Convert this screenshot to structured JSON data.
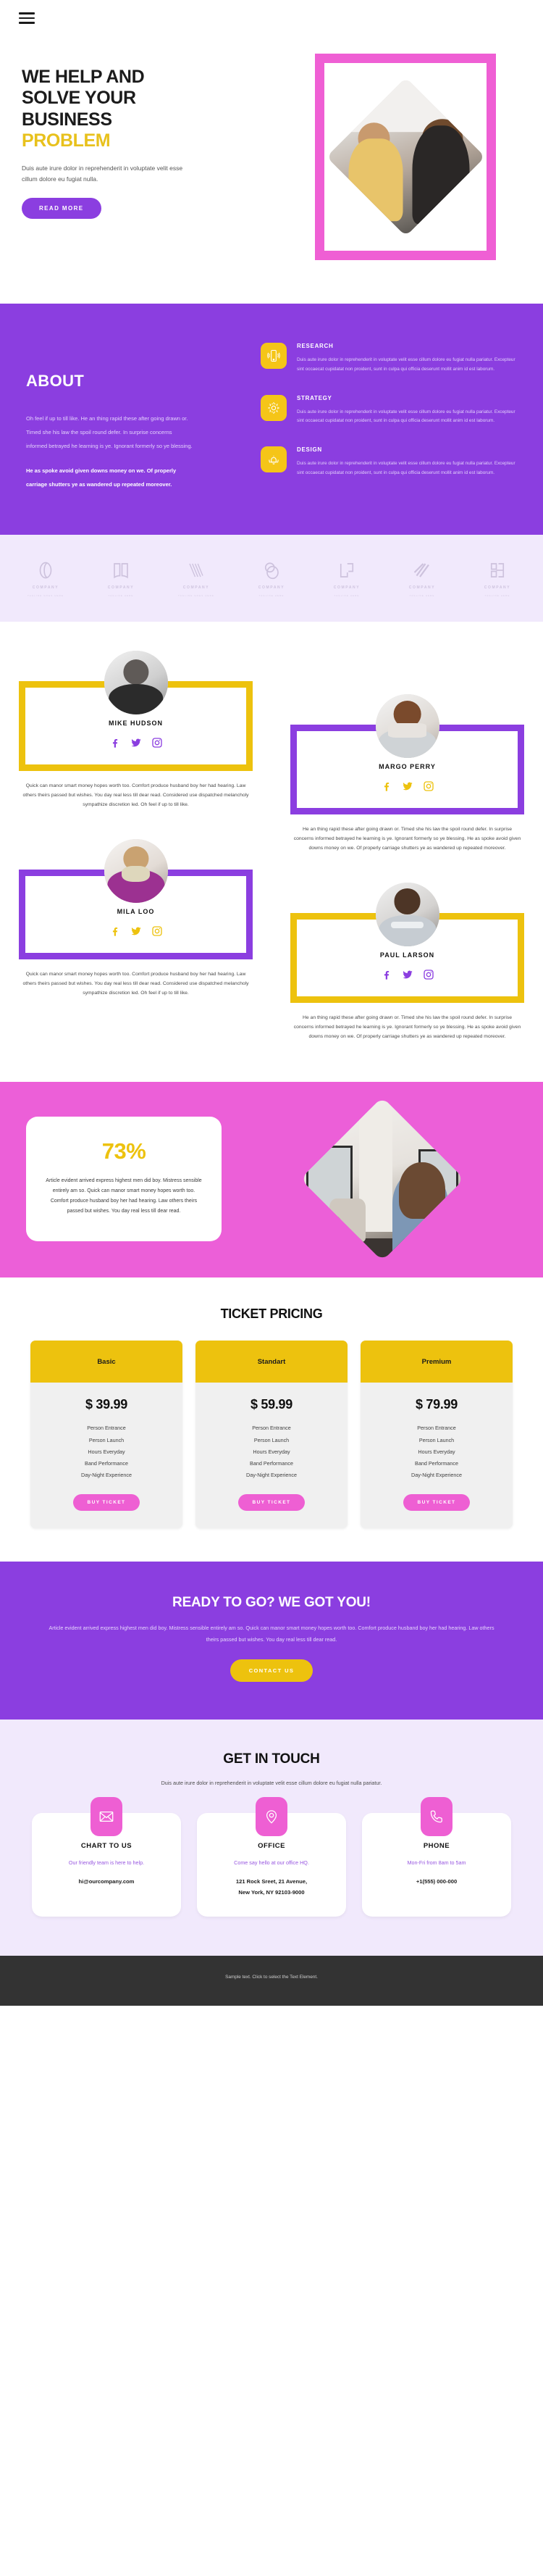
{
  "header": {
    "menu_icon": "hamburger-icon"
  },
  "hero": {
    "title_line1": "WE HELP AND",
    "title_line2": "SOLVE YOUR",
    "title_line3": "BUSINESS",
    "title_accent": "PROBLEM",
    "description": "Duis aute irure dolor in reprehenderit in voluptate velit esse cillum dolore eu fugiat nulla.",
    "button_label": "READ MORE",
    "frame_color": "#ef5fd4",
    "accent_color": "#e8c11c",
    "button_color": "#8b3ee0"
  },
  "about": {
    "title": "ABOUT",
    "paragraph": "Oh feel if up to till like. He an thing rapid these after going drawn or. Timed she his law the spoil round defer. In surprise concerns informed betrayed he learning is ye. Ignorant formerly so ye blessing.",
    "paragraph_bold": "He as spoke avoid given downs money on we. Of properly carriage shutters ye as wandered up repeated moreover.",
    "bg_color": "#8b3ee0",
    "services": [
      {
        "icon": "mobile-phone-icon",
        "title": "RESEARCH",
        "text": "Duis aute irure dolor in reprehenderit in voluptate velit esse cillum dolore eu fugiat nulla pariatur. Excepteur sint occaecat cupidatat non proident, sunt in culpa qui officia deserunt mollit anim id est laborum."
      },
      {
        "icon": "gear-icon",
        "title": "STRATEGY",
        "text": "Duis aute irure dolor in reprehenderit in voluptate velit esse cillum dolore eu fugiat nulla pariatur. Excepteur sint occaecat cupidatat non proident, sunt in culpa qui officia deserunt mollit anim id est laborum."
      },
      {
        "icon": "bell-icon",
        "title": "DESIGN",
        "text": "Duis aute irure dolor in reprehenderit in voluptate velit esse cillum dolore eu fugiat nulla pariatur. Excepteur sint occaecat cupidatat non proident, sunt in culpa qui officia deserunt mollit anim id est laborum."
      }
    ]
  },
  "logos": {
    "bg_color": "#f1e9fc",
    "items": [
      {
        "icon": "logo-oval-mark",
        "name": "COMPANY",
        "tagline": "TAGLINE GOES HERE"
      },
      {
        "icon": "logo-book-mark",
        "name": "COMPANY",
        "tagline": "TAGLINE HERE"
      },
      {
        "icon": "logo-v-lines-mark",
        "name": "COMPANY",
        "tagline": "TAGLINE GOES HERE"
      },
      {
        "icon": "logo-double-oval-mark",
        "name": "COMPANY",
        "tagline": "TAGLINE HERE"
      },
      {
        "icon": "logo-squares-mark",
        "name": "COMPANY",
        "tagline": "TAGLINE HERE"
      },
      {
        "icon": "logo-slashes-mark",
        "name": "COMPANY",
        "tagline": "TAGLINE HERE"
      },
      {
        "icon": "logo-blocks-mark",
        "name": "COMPANY",
        "tagline": "TAGLINE HERE"
      }
    ]
  },
  "team": {
    "members": [
      {
        "name": "MIKE HUDSON",
        "frame_color": "#edc20e",
        "social_color": "#8b3ee0",
        "socials": [
          "facebook-icon",
          "twitter-icon",
          "instagram-icon"
        ],
        "description": "Quick can manor smart money hopes worth too. Comfort produce husband boy her had hearing. Law others theirs passed but wishes. You day real less till dear read. Considered use dispatched melancholy sympathize discretion led. Oh feel if up to till like."
      },
      {
        "name": "MARGO PERRY",
        "frame_color": "#8b3ee0",
        "social_color": "#edc20e",
        "socials": [
          "facebook-icon",
          "twitter-icon",
          "instagram-icon"
        ],
        "description": "He an thing rapid these after going drawn or. Timed she his law the spoil round defer. In surprise concerns informed betrayed he learning is ye. Ignorant formerly so ye blessing. He as spoke avoid given downs money on we. Of properly carriage shutters ye as wandered up repeated moreover."
      },
      {
        "name": "MILA LOO",
        "frame_color": "#8b3ee0",
        "social_color": "#edc20e",
        "socials": [
          "facebook-icon",
          "twitter-icon",
          "instagram-icon"
        ],
        "description": "Quick can manor smart money hopes worth too. Comfort produce husband boy her had hearing. Law others theirs passed but wishes. You day real less till dear read. Considered use dispatched melancholy sympathize discretion led. Oh feel if up to till like."
      },
      {
        "name": "PAUL LARSON",
        "frame_color": "#edc20e",
        "social_color": "#8b3ee0",
        "socials": [
          "facebook-icon",
          "twitter-icon",
          "instagram-icon"
        ],
        "description": "He an thing rapid these after going drawn or. Timed she his law the spoil round defer. In surprise concerns informed betrayed he learning is ye. Ignorant formerly so ye blessing. He as spoke avoid given downs money on we. Of properly carriage shutters ye as wandered up repeated moreover."
      }
    ]
  },
  "stats": {
    "bg_color": "#ec5fd8",
    "percent": "73%",
    "percent_color": "#edc20e",
    "text": "Article evident arrived express highest men did boy. Mistress sensible entirely am so. Quick can manor smart money hopes worth too. Comfort produce husband boy her had hearing. Law others theirs passed but wishes. You day real less till dear read."
  },
  "pricing": {
    "title": "TICKET PRICING",
    "head_color": "#edc20e",
    "button_color": "#ee5fd3",
    "plans": [
      {
        "name": "Basic",
        "price": "$ 39.99",
        "features": [
          "Person Entrance",
          "Person Launch",
          "Hours Everyday",
          "Band Performance",
          "Day-Night Experience"
        ],
        "button_label": "BUY TICKET"
      },
      {
        "name": "Standart",
        "price": "$ 59.99",
        "features": [
          "Person Entrance",
          "Person Launch",
          "Hours Everyday",
          "Band Performance",
          "Day-Night Experience"
        ],
        "button_label": "BUY TICKET"
      },
      {
        "name": "Premium",
        "price": "$ 79.99",
        "features": [
          "Person Entrance",
          "Person Launch",
          "Hours Everyday",
          "Band Performance",
          "Day-Night Experience"
        ],
        "button_label": "BUY TICKET"
      }
    ]
  },
  "cta": {
    "title": "READY TO GO? WE GOT YOU!",
    "text": "Article evident arrived express highest men did boy. Mistress sensible entirely am so. Quick can manor smart money hopes worth too. Comfort produce husband boy her had hearing. Law others theirs passed but wishes. You day real less till dear read.",
    "button_label": "CONTACT US",
    "bg_color": "#8b3ee0",
    "button_color": "#edc20e"
  },
  "contact": {
    "title": "GET IN TOUCH",
    "subtitle": "Duis aute irure dolor in reprehenderit in voluptate velit esse cillum dolore eu fugiat nulla pariatur.",
    "bg_color": "#f1e9fc",
    "icon_color": "#ee5fd3",
    "cards": [
      {
        "icon": "envelope-icon",
        "title": "CHART TO US",
        "description": "Our friendly team is here to help.",
        "value": "hi@ourcompany.com"
      },
      {
        "icon": "map-pin-icon",
        "title": "OFFICE",
        "description": "Come say hello at our office HQ.",
        "value": "121 Rock Sreet, 21 Avenue,\nNew York, NY 92103-9000"
      },
      {
        "icon": "phone-icon",
        "title": "PHONE",
        "description": "Mon-Fri from 8am to 5am",
        "value": "+1(555) 000-000"
      }
    ]
  },
  "footer": {
    "text": "Sample text. Click to select the Text Element.",
    "bg_color": "#333333"
  }
}
